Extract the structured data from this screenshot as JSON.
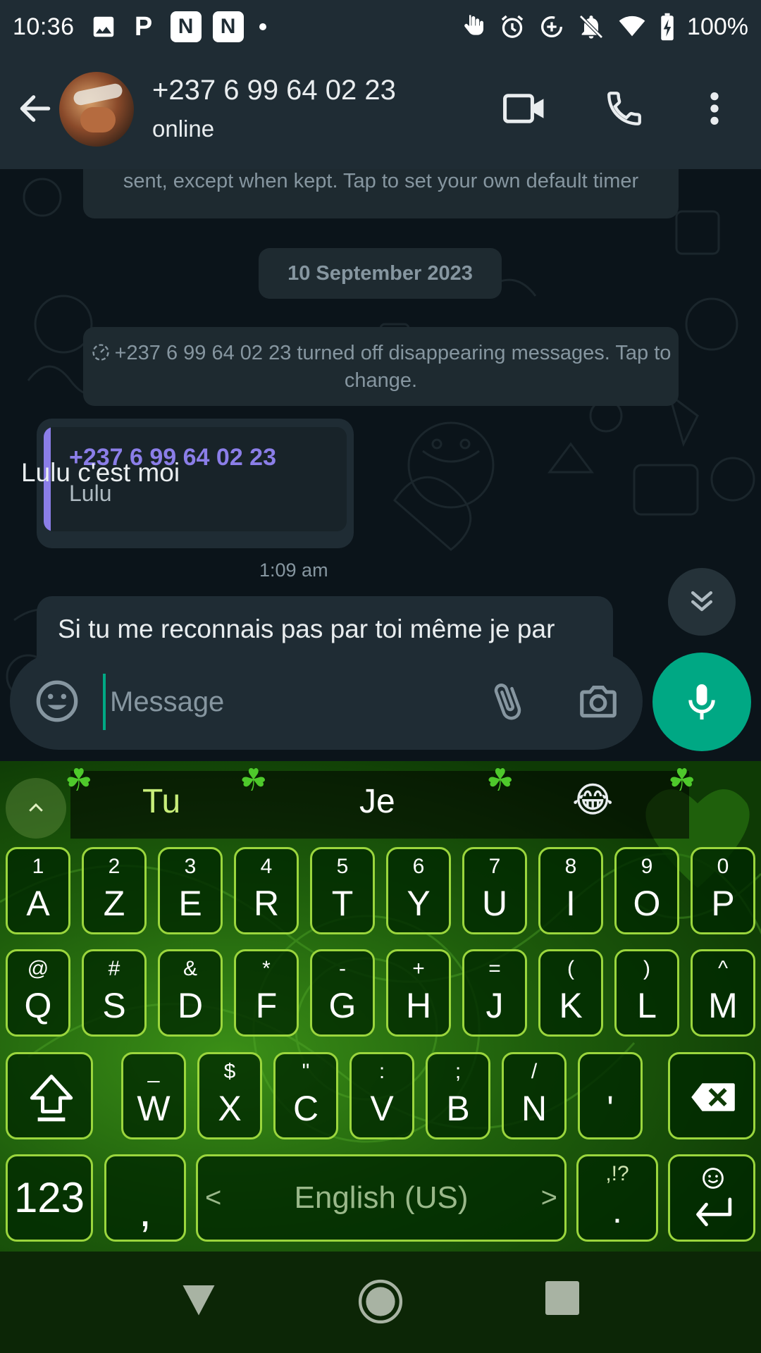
{
  "status_bar": {
    "time": "10:36",
    "battery": "100%",
    "left_icons": [
      "image-icon",
      "p-app-icon",
      "n-app-icon",
      "n-app-icon",
      "dot-icon"
    ],
    "right_icons": [
      "gesture-icon",
      "alarm-icon",
      "data-saver-icon",
      "mute-icon",
      "wifi-icon",
      "battery-charging-icon"
    ],
    "notif_letters": [
      "P",
      "N",
      "N"
    ]
  },
  "header": {
    "contact_name": "+237 6 99 64 02 23",
    "contact_status": "online"
  },
  "chat": {
    "system_timer_text": "sent, except when kept. Tap to set your own default timer",
    "date_chip": "10 September 2023",
    "system_disappear_text": "+237 6 99 64 02 23 turned off disappearing messages. Tap to change.",
    "messages": [
      {
        "quoted_name": "+237 6 99 64 02 23",
        "quoted_text": "Lulu",
        "text": "Lulu c'est moi",
        "time": "1:09 am"
      },
      {
        "text": "Si tu me reconnais pas par toi même je par"
      }
    ]
  },
  "composer": {
    "placeholder": "Message"
  },
  "keyboard": {
    "suggestions": [
      "Tu",
      "Je",
      "😂"
    ],
    "row1": [
      {
        "hint": "1",
        "label": "A"
      },
      {
        "hint": "2",
        "label": "Z"
      },
      {
        "hint": "3",
        "label": "E"
      },
      {
        "hint": "4",
        "label": "R"
      },
      {
        "hint": "5",
        "label": "T"
      },
      {
        "hint": "6",
        "label": "Y"
      },
      {
        "hint": "7",
        "label": "U"
      },
      {
        "hint": "8",
        "label": "I"
      },
      {
        "hint": "9",
        "label": "O"
      },
      {
        "hint": "0",
        "label": "P"
      }
    ],
    "row2": [
      {
        "hint": "@",
        "label": "Q"
      },
      {
        "hint": "#",
        "label": "S"
      },
      {
        "hint": "&",
        "label": "D"
      },
      {
        "hint": "*",
        "label": "F"
      },
      {
        "hint": "-",
        "label": "G"
      },
      {
        "hint": "+",
        "label": "H"
      },
      {
        "hint": "=",
        "label": "J"
      },
      {
        "hint": "(",
        "label": "K"
      },
      {
        "hint": ")",
        "label": "L"
      },
      {
        "hint": "^",
        "label": "M"
      }
    ],
    "row3": [
      {
        "hint": "_",
        "label": "W"
      },
      {
        "hint": "$",
        "label": "X"
      },
      {
        "hint": "\"",
        "label": "C"
      },
      {
        "hint": ":",
        "label": "V"
      },
      {
        "hint": ";",
        "label": "B"
      },
      {
        "hint": "/",
        "label": "N"
      },
      {
        "hint": "",
        "label": "'"
      }
    ],
    "symbols_label": "123",
    "comma_label": ",",
    "space_label": "English (US)",
    "period_hint": ",!?",
    "period_label": ".",
    "space_left_arrow": "<",
    "space_right_arrow": ">"
  },
  "colors": {
    "accent": "#00a884",
    "header_bg": "#1f2c34",
    "quote_name": "#8b7ee8",
    "key_border": "#9bd63d",
    "suggestion_highlight": "#c8ee7a"
  }
}
